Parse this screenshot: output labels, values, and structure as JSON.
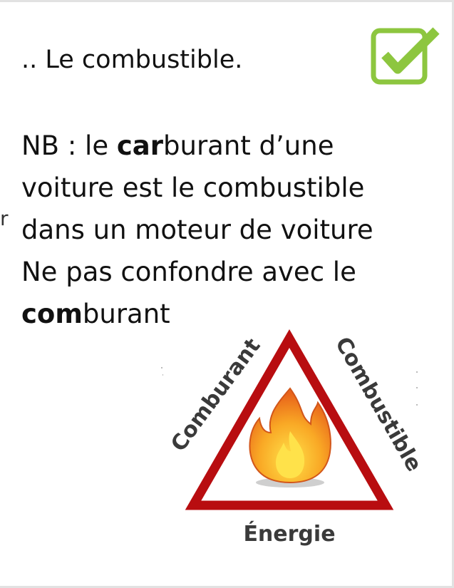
{
  "answer": ".. Le combustible.",
  "note": {
    "line1": {
      "before": "NB : le ",
      "bold": "car",
      "after": "burant d’une"
    },
    "line2": "voiture est le combustible",
    "line3": "dans un moteur de voiture",
    "line4": "Ne pas confondre avec le",
    "line5": {
      "bold": "com",
      "after": "burant"
    }
  },
  "stray_mark": "r",
  "diagram": {
    "left_label": "Comburant",
    "right_label": "Combustible",
    "bottom_label": "Énergie"
  },
  "colors": {
    "check_green": "#8dc63f",
    "triangle_red": "#b80d10",
    "label_gray": "#3a3a3a",
    "flame_orange": "#f08a1c",
    "flame_yellow": "#ffe24a"
  },
  "icons": {
    "check": "checkbox-checked-icon",
    "fire": "fire-icon"
  }
}
